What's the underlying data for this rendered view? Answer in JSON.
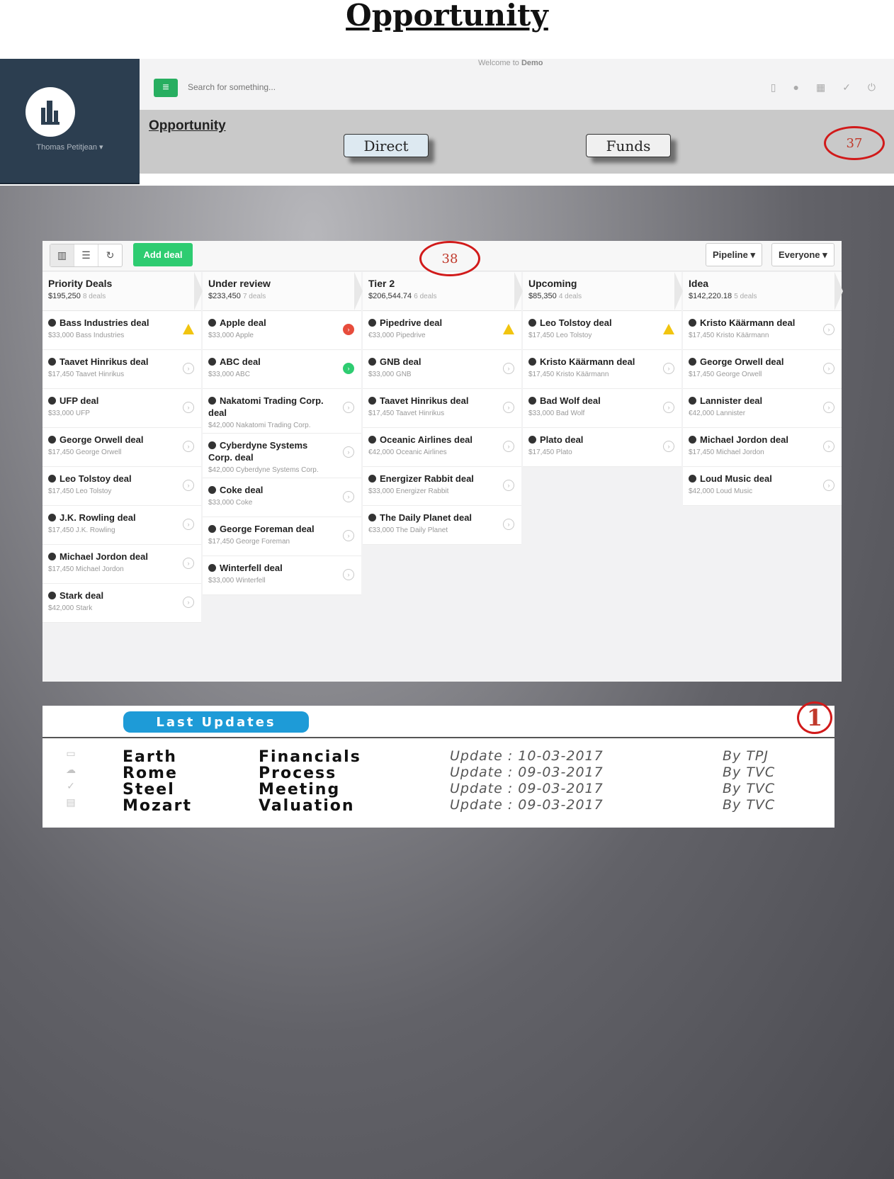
{
  "page_title": "Opportunity",
  "app": {
    "welcome_prefix": "Welcome to ",
    "welcome_brand": "Demo",
    "user_name": "Thomas Petitjean ▾",
    "search_placeholder": "Search for something...",
    "subheader_title": "Opportunity",
    "tabs": {
      "direct": "Direct",
      "funds": "Funds"
    }
  },
  "callouts": {
    "c37": "37",
    "c38": "38",
    "c1": "1"
  },
  "board": {
    "add_deal": "Add deal",
    "pipeline_label": "Pipeline ▾",
    "everyone_label": "Everyone ▾",
    "columns": [
      {
        "name": "Priority Deals",
        "sum": "$195,250",
        "count": "8 deals",
        "cards": [
          {
            "title": "Bass Industries deal",
            "sub": "$33,000  Bass Industries",
            "status": "warn"
          },
          {
            "title": "Taavet Hinrikus deal",
            "sub": "$17,450  Taavet Hinrikus",
            "status": "grey"
          },
          {
            "title": "UFP deal",
            "sub": "$33,000  UFP",
            "status": "grey"
          },
          {
            "title": "George Orwell deal",
            "sub": "$17,450  George Orwell",
            "status": "grey"
          },
          {
            "title": "Leo Tolstoy deal",
            "sub": "$17,450  Leo Tolstoy",
            "status": "grey"
          },
          {
            "title": "J.K. Rowling deal",
            "sub": "$17,450  J.K. Rowling",
            "status": "grey"
          },
          {
            "title": "Michael Jordon deal",
            "sub": "$17,450  Michael Jordon",
            "status": "grey"
          },
          {
            "title": "Stark deal",
            "sub": "$42,000  Stark",
            "status": "grey"
          }
        ]
      },
      {
        "name": "Under review",
        "sum": "$233,450",
        "count": "7 deals",
        "cards": [
          {
            "title": "Apple deal",
            "sub": "$33,000  Apple",
            "status": "red"
          },
          {
            "title": "ABC deal",
            "sub": "$33,000  ABC",
            "status": "green"
          },
          {
            "title": "Nakatomi Trading Corp. deal",
            "sub": "$42,000  Nakatomi Trading Corp.",
            "status": "grey",
            "tall": true
          },
          {
            "title": "Cyberdyne Systems Corp. deal",
            "sub": "$42,000  Cyberdyne Systems Corp.",
            "status": "grey",
            "tall": true
          },
          {
            "title": "Coke deal",
            "sub": "$33,000  Coke",
            "status": "grey"
          },
          {
            "title": "George Foreman deal",
            "sub": "$17,450  George Foreman",
            "status": "grey"
          },
          {
            "title": "Winterfell deal",
            "sub": "$33,000  Winterfell",
            "status": "grey"
          }
        ]
      },
      {
        "name": "Tier 2",
        "sum": "$206,544.74",
        "count": "6 deals",
        "cards": [
          {
            "title": "Pipedrive deal",
            "sub": "€33,000  Pipedrive",
            "status": "warn"
          },
          {
            "title": "GNB deal",
            "sub": "$33,000  GNB",
            "status": "grey"
          },
          {
            "title": "Taavet Hinrikus deal",
            "sub": "$17,450  Taavet Hinrikus",
            "status": "grey"
          },
          {
            "title": "Oceanic Airlines deal",
            "sub": "€42,000  Oceanic Airlines",
            "status": "grey"
          },
          {
            "title": "Energizer Rabbit deal",
            "sub": "$33,000  Energizer Rabbit",
            "status": "grey"
          },
          {
            "title": "The Daily Planet deal",
            "sub": "€33,000  The Daily Planet",
            "status": "grey"
          }
        ]
      },
      {
        "name": "Upcoming",
        "sum": "$85,350",
        "count": "4 deals",
        "cards": [
          {
            "title": "Leo Tolstoy deal",
            "sub": "$17,450  Leo Tolstoy",
            "status": "warn"
          },
          {
            "title": "Kristo Käärmann deal",
            "sub": "$17,450  Kristo Käärmann",
            "status": "grey"
          },
          {
            "title": "Bad Wolf deal",
            "sub": "$33,000  Bad Wolf",
            "status": "grey"
          },
          {
            "title": "Plato deal",
            "sub": "$17,450  Plato",
            "status": "grey"
          }
        ]
      },
      {
        "name": "Idea",
        "sum": "$142,220.18",
        "count": "5 deals",
        "cards": [
          {
            "title": "Kristo Käärmann deal",
            "sub": "$17,450  Kristo Käärmann",
            "status": "grey"
          },
          {
            "title": "George Orwell deal",
            "sub": "$17,450  George Orwell",
            "status": "grey"
          },
          {
            "title": "Lannister deal",
            "sub": "€42,000  Lannister",
            "status": "grey"
          },
          {
            "title": "Michael Jordon deal",
            "sub": "$17,450  Michael Jordon",
            "status": "grey"
          },
          {
            "title": "Loud Music deal",
            "sub": "$42,000  Loud Music",
            "status": "grey"
          }
        ]
      }
    ]
  },
  "updates": {
    "header": "Last Updates",
    "rows": [
      {
        "name": "Earth",
        "topic": "Financials",
        "date": "Update : 10-03-2017",
        "by": "By TPJ"
      },
      {
        "name": "Rome",
        "topic": "Process",
        "date": "Update : 09-03-2017",
        "by": "By TVC"
      },
      {
        "name": "Steel",
        "topic": "Meeting",
        "date": "Update : 09-03-2017",
        "by": "By TVC"
      },
      {
        "name": "Mozart",
        "topic": "Valuation",
        "date": "Update : 09-03-2017",
        "by": "By TVC"
      }
    ]
  }
}
